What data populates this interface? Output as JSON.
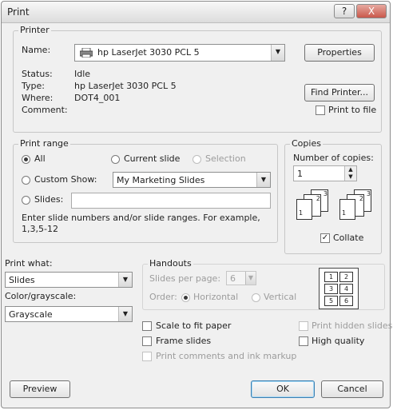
{
  "window": {
    "title": "Print",
    "help_label": "?",
    "close_label": "X"
  },
  "printer": {
    "group_label": "Printer",
    "name_label": "Name:",
    "name_value": "hp LaserJet 3030 PCL 5",
    "properties_label": "Properties",
    "find_printer_label": "Find Printer...",
    "status_label": "Status:",
    "status_value": "Idle",
    "type_label": "Type:",
    "type_value": "hp LaserJet 3030 PCL 5",
    "where_label": "Where:",
    "where_value": "DOT4_001",
    "comment_label": "Comment:",
    "print_to_file_label": "Print to file",
    "print_to_file_checked": false
  },
  "print_range": {
    "group_label": "Print range",
    "all_label": "All",
    "current_slide_label": "Current slide",
    "selection_label": "Selection",
    "custom_show_label": "Custom Show:",
    "custom_show_value": "My Marketing Slides",
    "slides_label": "Slides:",
    "slides_value": "",
    "help_text": "Enter slide numbers and/or slide ranges. For example, 1,3,5-12",
    "selected": "All"
  },
  "copies": {
    "group_label": "Copies",
    "number_label": "Number of copies:",
    "number_value": "1",
    "collate_label": "Collate",
    "collate_checked": true,
    "stack1": [
      "1",
      "2",
      "3"
    ],
    "stack2": [
      "1",
      "2",
      "3"
    ]
  },
  "print_what": {
    "label": "Print what:",
    "value": "Slides"
  },
  "color": {
    "label": "Color/grayscale:",
    "value": "Grayscale"
  },
  "handouts": {
    "group_label": "Handouts",
    "slides_per_page_label": "Slides per page:",
    "slides_per_page_value": "6",
    "order_label": "Order:",
    "horizontal_label": "Horizontal",
    "vertical_label": "Vertical",
    "order_selected": "Horizontal",
    "preview_cells": [
      "1",
      "2",
      "3",
      "4",
      "5",
      "6"
    ]
  },
  "options": {
    "scale_to_fit_label": "Scale to fit paper",
    "frame_slides_label": "Frame slides",
    "print_comments_label": "Print comments and ink markup",
    "print_hidden_label": "Print hidden slides",
    "high_quality_label": "High quality"
  },
  "buttons": {
    "preview_label": "Preview",
    "ok_label": "OK",
    "cancel_label": "Cancel"
  }
}
